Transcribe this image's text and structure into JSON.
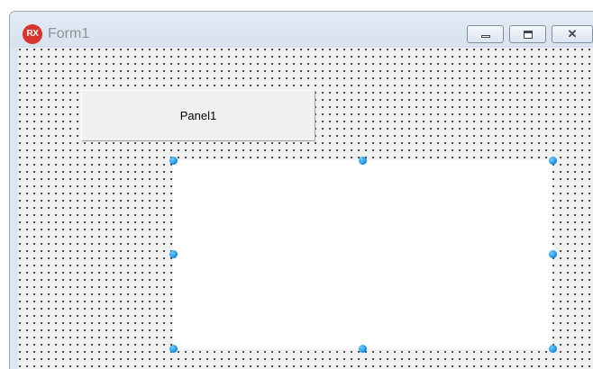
{
  "window": {
    "app_icon_text": "RX",
    "title": "Form1",
    "controls": {
      "minimize_icon": "minimize-icon",
      "maximize_icon": "maximize-icon",
      "close_glyph": "✕"
    }
  },
  "form": {
    "panel1": {
      "caption": "Panel1"
    },
    "panel2": {
      "caption": "",
      "selected": true
    }
  },
  "colors": {
    "app_icon_bg": "#d8352f",
    "selection_handle": "#1188dd",
    "form_bg": "#f0f0f0"
  }
}
